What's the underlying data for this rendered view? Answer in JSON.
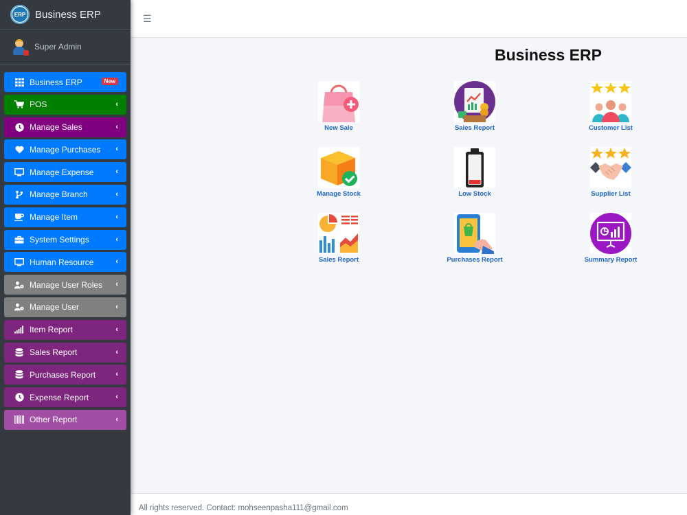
{
  "brand": {
    "logo_text": "ERP",
    "title": "Business ERP"
  },
  "user": {
    "name": "Super Admin"
  },
  "sidebar": {
    "items": [
      {
        "label": "Business ERP",
        "icon": "grid-icon",
        "badge": "New"
      },
      {
        "label": "POS",
        "icon": "cart-icon"
      },
      {
        "label": "Manage Sales",
        "icon": "clock-icon"
      },
      {
        "label": "Manage Purchases",
        "icon": "heart-icon"
      },
      {
        "label": "Manage Expense",
        "icon": "monitor-icon"
      },
      {
        "label": "Manage Branch",
        "icon": "branch-icon"
      },
      {
        "label": "Manage Item",
        "icon": "coffee-icon"
      },
      {
        "label": "System Settings",
        "icon": "toolbox-icon"
      },
      {
        "label": "Human Resource",
        "icon": "monitor-icon"
      },
      {
        "label": "Manage User Roles",
        "icon": "user-cog-icon"
      },
      {
        "label": "Manage User",
        "icon": "user-clock-icon"
      },
      {
        "label": "Item Report",
        "icon": "signal-icon"
      },
      {
        "label": "Sales Report",
        "icon": "database-icon"
      },
      {
        "label": "Purchases Report",
        "icon": "database-icon"
      },
      {
        "label": "Expense Report",
        "icon": "clock-icon"
      },
      {
        "label": "Other Report",
        "icon": "barcode-icon"
      }
    ]
  },
  "main": {
    "title": "Business ERP",
    "tiles": [
      {
        "label": "New Sale",
        "icon": "shopping-bag-plus-icon"
      },
      {
        "label": "Sales Report",
        "icon": "sales-report-icon"
      },
      {
        "label": "Customer List",
        "icon": "customers-stars-icon"
      },
      {
        "label": "Manage Stock",
        "icon": "box-check-icon"
      },
      {
        "label": "Low Stock",
        "icon": "low-battery-icon"
      },
      {
        "label": "Supplier List",
        "icon": "handshake-stars-icon"
      },
      {
        "label": "Sales Report",
        "icon": "charts-icon"
      },
      {
        "label": "Purchases Report",
        "icon": "mobile-shopping-icon"
      },
      {
        "label": "Summary Report",
        "icon": "presentation-icon"
      }
    ]
  },
  "footer": {
    "text": "All rights reserved. Contact: mohseenpasha111@gmail.com"
  },
  "colors": {
    "sidebar_bg": "#343a40",
    "blue": "#007bff",
    "green": "#008000",
    "purple": "#800080",
    "gray": "#808080",
    "violet": "#7e267e",
    "pink": "#a24ea4",
    "tile_label": "#1f65c8"
  }
}
